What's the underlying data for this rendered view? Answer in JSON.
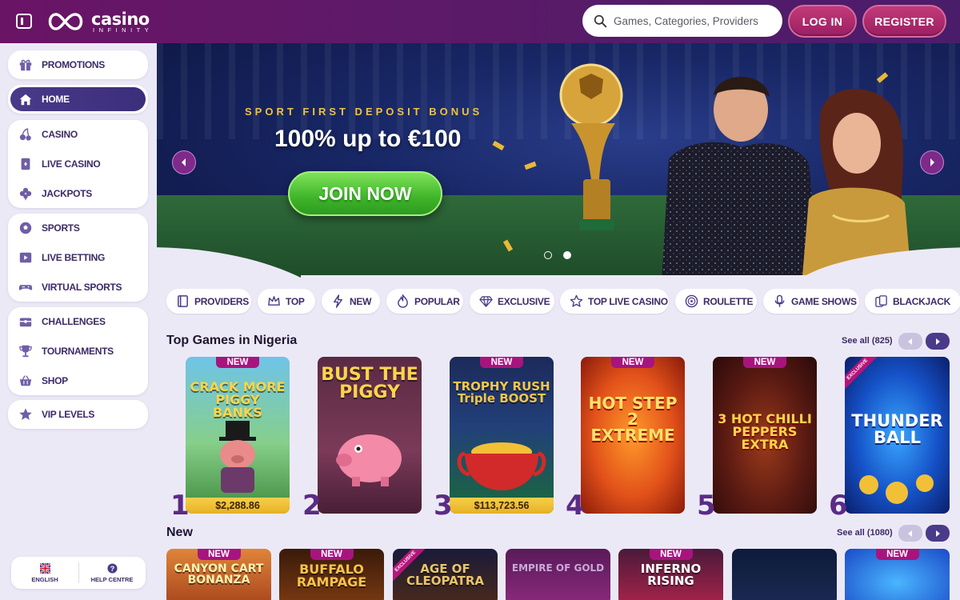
{
  "brand": {
    "name": "casino",
    "sub": "INFINITY"
  },
  "header": {
    "search_placeholder": "Games, Categories, Providers",
    "login_label": "LOG IN",
    "register_label": "REGISTER"
  },
  "sidebar": {
    "items": [
      {
        "label": "PROMOTIONS",
        "icon": "gift-icon"
      },
      {
        "label": "HOME",
        "icon": "home-icon"
      },
      {
        "label": "CASINO",
        "icon": "cherries-icon"
      },
      {
        "label": "LIVE CASINO",
        "icon": "card-icon"
      },
      {
        "label": "JACKPOTS",
        "icon": "clover-icon"
      },
      {
        "label": "SPORTS",
        "icon": "soccer-ball-icon"
      },
      {
        "label": "LIVE BETTING",
        "icon": "play-icon"
      },
      {
        "label": "VIRTUAL SPORTS",
        "icon": "gamepad-icon"
      },
      {
        "label": "CHALLENGES",
        "icon": "chest-icon"
      },
      {
        "label": "TOURNAMENTS",
        "icon": "trophy-icon"
      },
      {
        "label": "SHOP",
        "icon": "basket-icon"
      },
      {
        "label": "VIP LEVELS",
        "icon": "star-icon"
      }
    ],
    "footer": {
      "language": "ENGLISH",
      "help": "HELP CENTRE"
    }
  },
  "hero": {
    "kicker": "SPORT FIRST DEPOSIT BONUS",
    "title": "100% up to €100",
    "cta": "JOIN NOW"
  },
  "chips": [
    {
      "label": "PROVIDERS",
      "icon": "book-icon"
    },
    {
      "label": "TOP",
      "icon": "crown-icon"
    },
    {
      "label": "NEW",
      "icon": "lightning-icon"
    },
    {
      "label": "POPULAR",
      "icon": "flame-icon"
    },
    {
      "label": "EXCLUSIVE",
      "icon": "diamond-icon"
    },
    {
      "label": "TOP LIVE CASINO",
      "icon": "star-icon"
    },
    {
      "label": "ROULETTE",
      "icon": "roulette-icon"
    },
    {
      "label": "GAME SHOWS",
      "icon": "microphone-icon"
    },
    {
      "label": "BLACKJACK",
      "icon": "cards-icon"
    }
  ],
  "top_games": {
    "title": "Top Games in Nigeria",
    "see_all": "See all (825)",
    "games": [
      {
        "rank": "1",
        "name": "CRACK MORE PIGGY BANKS",
        "badge": "NEW",
        "jackpot": "$2,288.86"
      },
      {
        "rank": "2",
        "name": "BUST THE PIGGY",
        "badge": "",
        "jackpot": ""
      },
      {
        "rank": "3",
        "name": "TROPHY RUSH Triple BOOST",
        "badge": "NEW",
        "jackpot": "$113,723.56"
      },
      {
        "rank": "4",
        "name": "HOT STEP 2 EXTREME",
        "badge": "NEW",
        "jackpot": ""
      },
      {
        "rank": "5",
        "name": "3 HOT CHILLI PEPPERS EXTRA",
        "badge": "NEW",
        "jackpot": ""
      },
      {
        "rank": "6",
        "name": "THUNDER BALL",
        "badge": "EXCLUSIVE",
        "jackpot": ""
      }
    ]
  },
  "new_games": {
    "title": "New",
    "see_all": "See all (1080)",
    "games": [
      {
        "name": "CANYON CART BONANZA",
        "badge": "NEW"
      },
      {
        "name": "BUFFALO RAMPAGE",
        "badge": "NEW"
      },
      {
        "name": "AGE OF CLEOPATRA",
        "badge": "EXCLUSIVE"
      },
      {
        "name": "EMPIRE OF GOLD",
        "badge": ""
      },
      {
        "name": "INFERNO RISING",
        "badge": "NEW"
      },
      {
        "name": "",
        "badge": ""
      },
      {
        "name": "",
        "badge": "NEW"
      }
    ]
  },
  "colors": {
    "header": "#5c1a68",
    "accent": "#9b1f62",
    "sidebar_active": "#3b2e7a",
    "cta_green": "#3fb52a",
    "jackpot_gold": "#e6b125"
  }
}
